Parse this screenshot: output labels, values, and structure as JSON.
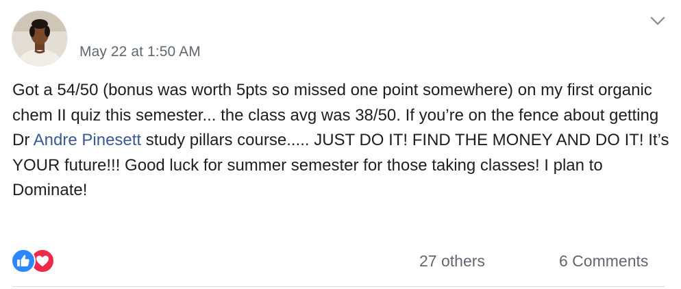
{
  "post": {
    "timestamp": "May 22 at 1:50 AM",
    "body": {
      "before_mention": "Got a 54/50 (bonus was worth 5pts so missed one point somewhere) on my first organic chem II quiz this semester... the class avg was 38/50. If you’re on the fence about getting Dr ",
      "mention": "Andre Pinesett",
      "after_mention": " study pillars course..... JUST DO IT! FIND THE MONEY AND DO IT! It’s YOUR future!!! Good luck for summer semester for those taking classes! I plan to Dominate!"
    },
    "reactions": {
      "icons": [
        "like-icon",
        "love-icon"
      ],
      "others_label": "27 others"
    },
    "comments_label": "6 Comments"
  },
  "colors": {
    "link": "#385898",
    "meta": "#606770",
    "text": "#1c1e21",
    "like": "#2d88ff",
    "love": "#f0284a",
    "divider": "#dadde1"
  }
}
